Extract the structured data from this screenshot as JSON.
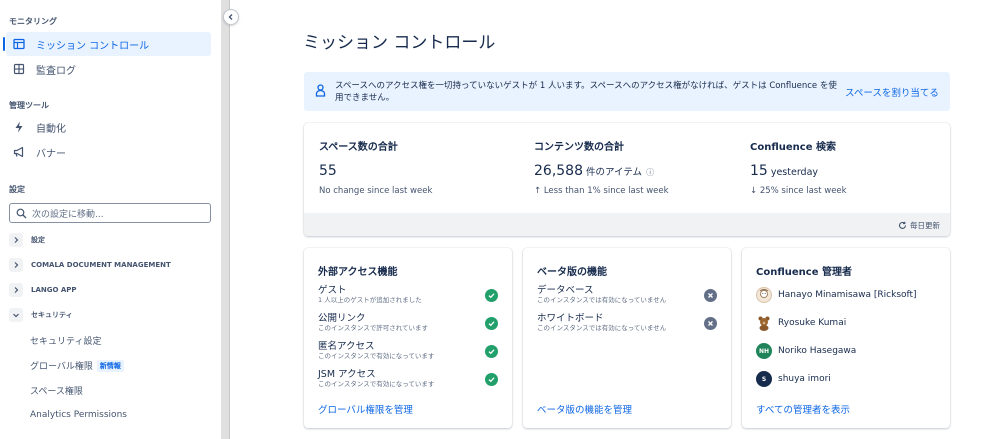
{
  "sidebar": {
    "monitoring_heading": "モニタリング",
    "mission_control": "ミッション コントロール",
    "audit_log": "監査ログ",
    "admin_tools_heading": "管理ツール",
    "automation": "自動化",
    "banner": "バナー",
    "settings_heading": "設定",
    "search_placeholder": "次の設定に移動...",
    "groups": {
      "settings": "設定",
      "comala": "COMALA DOCUMENT MANAGEMENT",
      "lango": "LANGO APP",
      "security": "セキュリティ"
    },
    "security_items": {
      "security_settings": "セキュリティ設定",
      "global_permissions": "グローバル権限",
      "new_badge": "新情報",
      "space_permissions": "スペース権限",
      "analytics_permissions": "Analytics Permissions"
    }
  },
  "page": {
    "title": "ミッション コントロール"
  },
  "banner": {
    "text": "スペースへのアクセス権を一切持っていないゲストが 1 人います。スペースへのアクセス権がなければ、ゲストは Confluence を使用できません。",
    "link": "スペースを割り当てる"
  },
  "stats": {
    "spaces": {
      "label": "スペース数の合計",
      "value": "55",
      "delta": "No change since last week"
    },
    "content": {
      "label": "コンテンツ数の合計",
      "value": "26,588",
      "unit": "件のアイテム",
      "info_glyph": "ⓘ",
      "delta": "Less than 1% since last week",
      "arrow": "↑"
    },
    "search": {
      "label": "Confluence 検索",
      "value": "15",
      "unit": "yesterday",
      "delta": "25% since last week",
      "arrow": "↓"
    },
    "updated": "毎日更新"
  },
  "external_access": {
    "title": "外部アクセス機能",
    "items": [
      {
        "name": "ゲスト",
        "desc": "1 人以上のゲストが追加されました"
      },
      {
        "name": "公開リンク",
        "desc": "このインスタンスで許可されています"
      },
      {
        "name": "匿名アクセス",
        "desc": "このインスタンスで有効になっています"
      },
      {
        "name": "JSM アクセス",
        "desc": "このインスタンスで有効になっています"
      }
    ],
    "link": "グローバル権限を管理"
  },
  "beta": {
    "title": "ベータ版の機能",
    "items": [
      {
        "name": "データベース",
        "desc": "このインスタンスでは有効になっていません"
      },
      {
        "name": "ホワイトボード",
        "desc": "このインスタンスでは有効になっていません"
      }
    ],
    "link": "ベータ版の機能を管理"
  },
  "admins": {
    "title": "Confluence 管理者",
    "list": [
      {
        "name": "Hanayo Minamisawa [Ricksoft]"
      },
      {
        "name": "Ryosuke Kumai"
      },
      {
        "name": "Noriko Hasegawa",
        "initials": "NH"
      },
      {
        "name": "shuya imori",
        "initials": "S"
      }
    ],
    "link": "すべての管理者を表示"
  },
  "colors": {
    "accent": "#0c66e4",
    "success": "#22a06b",
    "disabled": "#626f86",
    "banner_bg": "#e9f2ff"
  }
}
